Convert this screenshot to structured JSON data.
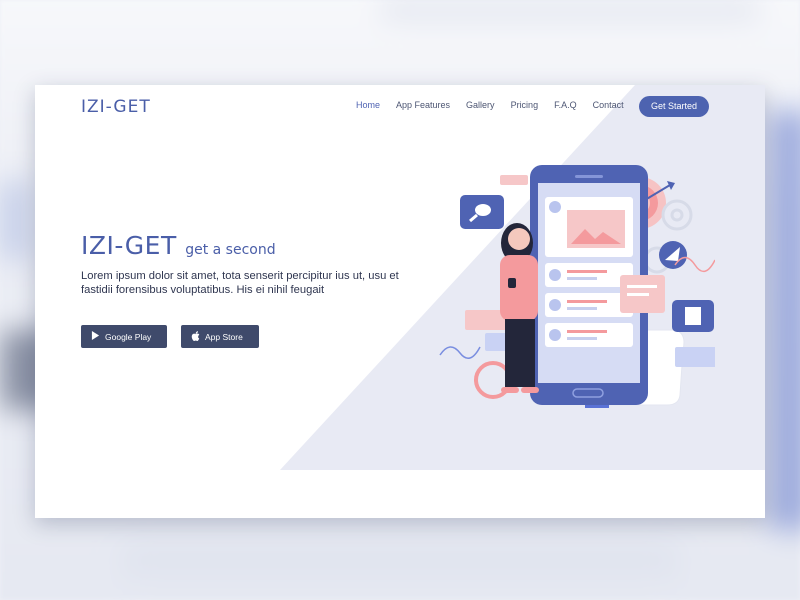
{
  "brand": "IZI-GET",
  "nav": {
    "items": [
      "Home",
      "App Features",
      "Gallery",
      "Pricing",
      "F.A.Q",
      "Contact"
    ],
    "active_index": 0,
    "cta_label": "Get Started"
  },
  "hero": {
    "title": "IZI-GET",
    "tagline": "get a second",
    "description": "Lorem ipsum dolor sit amet, tota senserit percipitur ius ut, usu et fastidii forensibus voluptatibus. His ei nihil feugait"
  },
  "buttons": {
    "google_play": {
      "label": "Google Play",
      "icon": "play-icon"
    },
    "app_store": {
      "label": "App Store",
      "icon": "apple-icon"
    }
  },
  "colors": {
    "accent": "#4d63b0",
    "dark_button": "#3f4a6b",
    "pink": "#f2a6a8",
    "panel_bg": "#e8eaf4"
  }
}
